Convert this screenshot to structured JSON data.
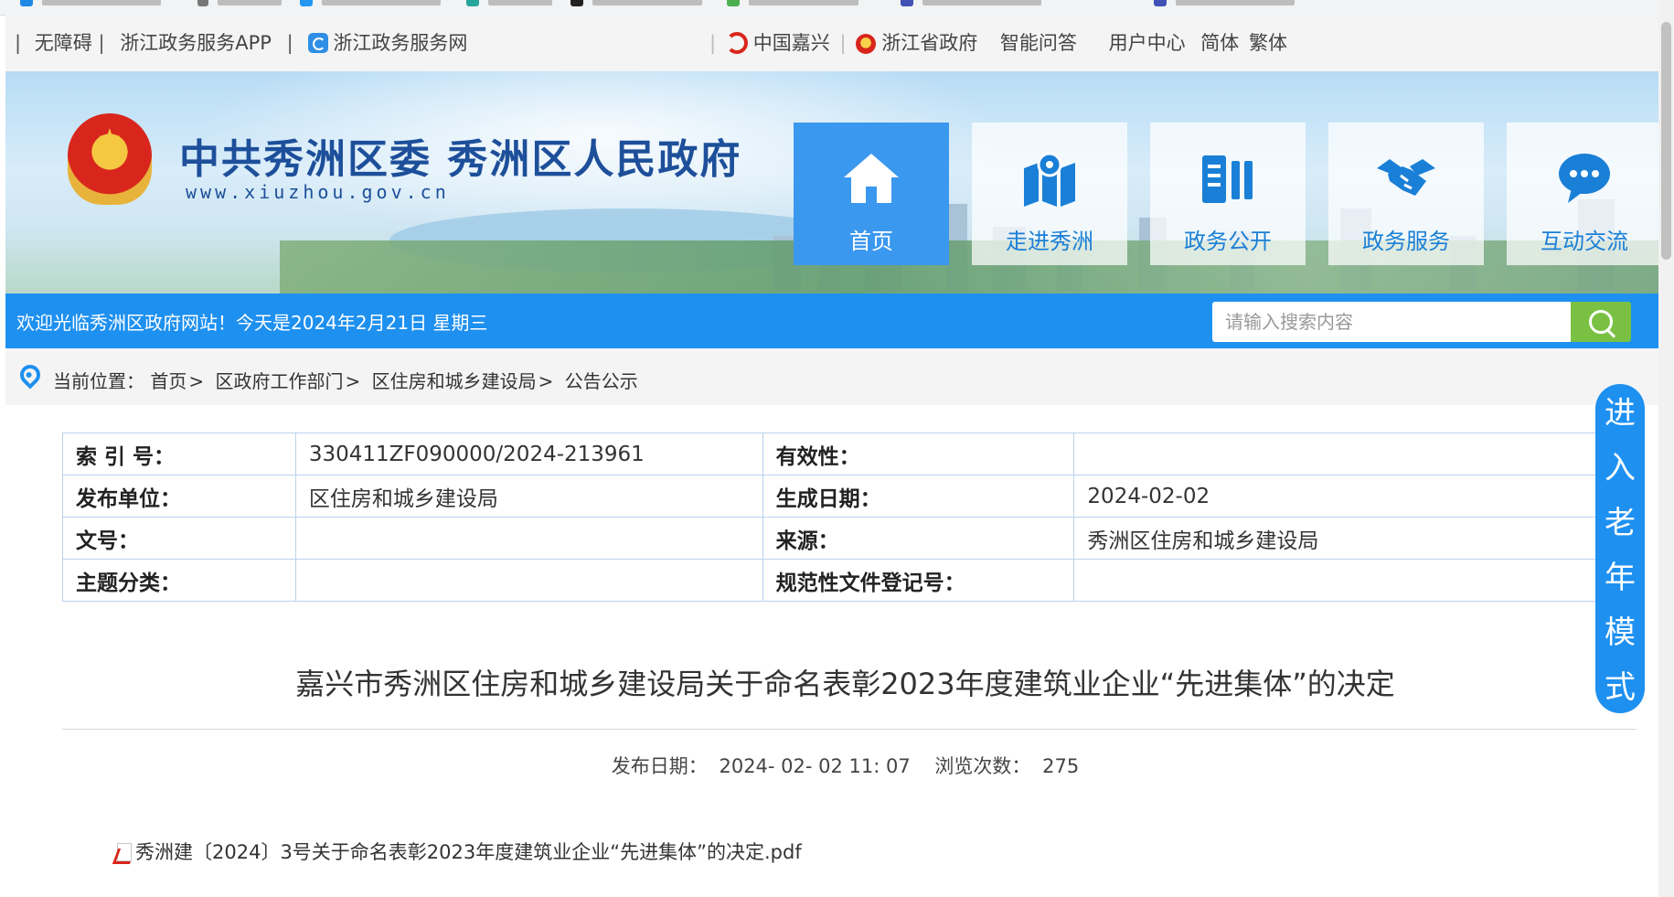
{
  "topbar": {
    "accessibility": "无障碍",
    "zj_app": "浙江政务服务APP",
    "zj_web": "浙江政务服务网",
    "china_jiaxing": "中国嘉兴",
    "zj_gov": "浙江省政府",
    "smart_qa": "智能问答",
    "user_center": "用户中心",
    "simplified": "简体",
    "traditional": "繁体",
    "separator": "|"
  },
  "header": {
    "site_title": "中共秀洲区委 秀洲区人民政府",
    "site_url": "www.xiuzhou.gov.cn"
  },
  "nav": [
    {
      "label": "首页",
      "icon": "home-icon",
      "active": true
    },
    {
      "label": "走进秀洲",
      "icon": "map-pin-icon",
      "active": false
    },
    {
      "label": "政务公开",
      "icon": "document-icon",
      "active": false
    },
    {
      "label": "政务服务",
      "icon": "handshake-icon",
      "active": false
    },
    {
      "label": "互动交流",
      "icon": "chat-icon",
      "active": false
    }
  ],
  "welcome": {
    "text": "欢迎光临秀洲区政府网站！今天是2024年2月21日 星期三"
  },
  "search": {
    "placeholder": "请输入搜索内容",
    "value": ""
  },
  "breadcrumb": {
    "prefix": "当前位置：",
    "items": [
      "首页",
      "区政府工作部门",
      "区住房和城乡建设局",
      "公告公示"
    ],
    "separator": ">"
  },
  "meta_table": {
    "rows": [
      {
        "k1": "索 引 号：",
        "v1": "330411ZF090000/2024-213961",
        "k2": "有效性：",
        "v2": ""
      },
      {
        "k1": "发布单位：",
        "v1": "区住房和城乡建设局",
        "k2": "生成日期：",
        "v2": "2024-02-02"
      },
      {
        "k1": "文号：",
        "v1": "",
        "k2": "来源：",
        "v2": "秀洲区住房和城乡建设局"
      },
      {
        "k1": "主题分类：",
        "v1": "",
        "k2": "规范性文件登记号：",
        "v2": ""
      }
    ]
  },
  "article": {
    "title": "嘉兴市秀洲区住房和城乡建设局关于命名表彰2023年度建筑业企业“先进集体”的决定",
    "publish_label": "发布日期：",
    "publish_date": "2024- 02- 02 11: 07",
    "views_label": "浏览次数：",
    "views": "275",
    "attachment": "秀洲建〔2024〕3号关于命名表彰2023年度建筑业企业“先进集体”的决定.pdf"
  },
  "elder_mode": {
    "chars": [
      "进",
      "入",
      "老",
      "年",
      "模",
      "式"
    ]
  },
  "colors": {
    "primary_blue": "#1e90f0",
    "search_green": "#7ac143",
    "title_blue": "#1d4f9a"
  }
}
